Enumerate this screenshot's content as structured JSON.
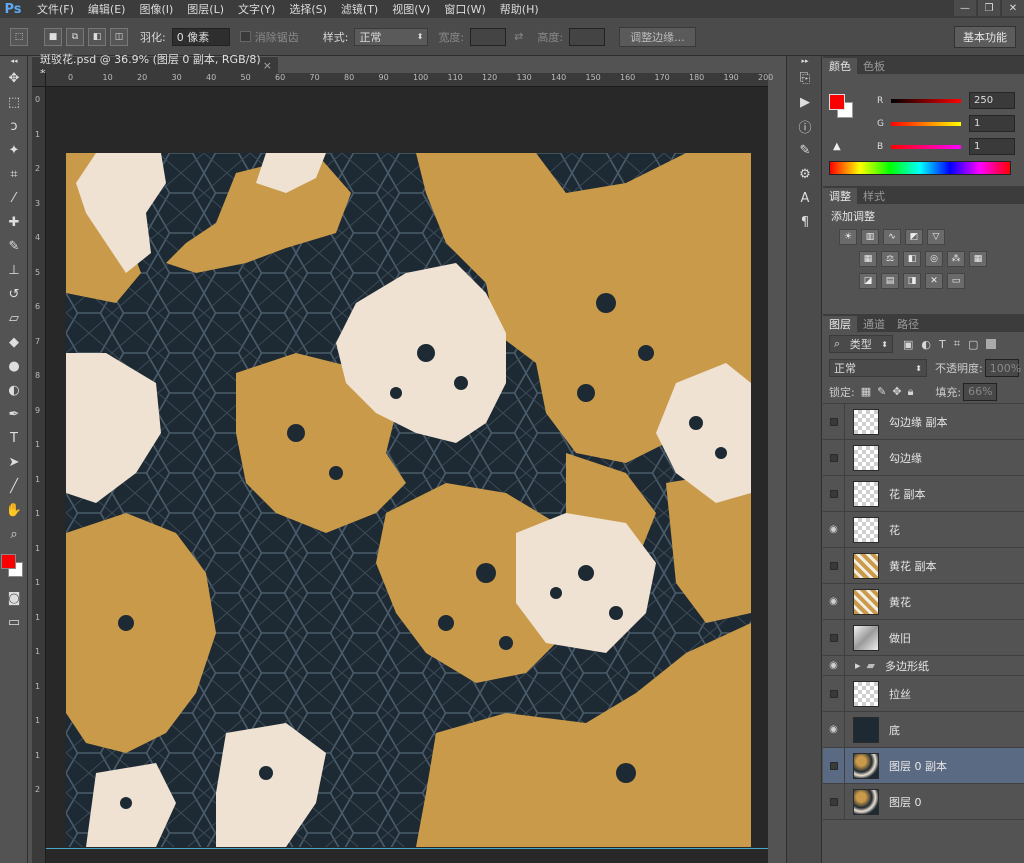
{
  "app": {
    "logo": "Ps"
  },
  "menubar": {
    "items": [
      "文件(F)",
      "编辑(E)",
      "图像(I)",
      "图层(L)",
      "文字(Y)",
      "选择(S)",
      "滤镜(T)",
      "视图(V)",
      "窗口(W)",
      "帮助(H)"
    ],
    "window_controls": [
      "—",
      "❐",
      "✕"
    ]
  },
  "options": {
    "feather_label": "羽化:",
    "feather_value": "0 像素",
    "antialias_label": "消除锯齿",
    "style_label": "样式:",
    "style_value": "正常",
    "width_label": "宽度:",
    "height_label": "高度:",
    "refine_edge_button": "调整边缘...",
    "workspace": "基本功能"
  },
  "document": {
    "tab_title": "斑驳花.psd @ 36.9% (图层 0 副本, RGB/8) *",
    "close": "×",
    "ruler_top_ticks": [
      "0",
      "10",
      "20",
      "30",
      "40",
      "50",
      "60",
      "70",
      "80",
      "90",
      "100",
      "110",
      "120",
      "130",
      "140",
      "150",
      "160",
      "170",
      "180",
      "190",
      "200"
    ],
    "ruler_left_ticks": [
      "0",
      "1",
      "2",
      "3",
      "4",
      "5",
      "6",
      "7",
      "8",
      "9",
      "1",
      "1",
      "1",
      "1",
      "1",
      "1",
      "1",
      "1",
      "1",
      "1",
      "2"
    ],
    "canvas_colors": {
      "background": "#1e2a33",
      "lattice": "#4a5c6b",
      "gold": "#c99a4a",
      "cream": "#efe2d2"
    }
  },
  "color_panel": {
    "tabs": [
      "颜色",
      "色板"
    ],
    "foreground": "#fa0101",
    "background": "#ffffff",
    "sliders": [
      {
        "label": "R",
        "value": "250"
      },
      {
        "label": "G",
        "value": "1"
      },
      {
        "label": "B",
        "value": "1"
      }
    ]
  },
  "adjustments_panel": {
    "tabs": [
      "调整",
      "样式"
    ],
    "title": "添加调整"
  },
  "layers_panel": {
    "tabs": [
      "图层",
      "通道",
      "路径"
    ],
    "filter_kind": "类型",
    "blend_mode": "正常",
    "opacity_label": "不透明度:",
    "opacity_value": "100%",
    "lock_label": "锁定:",
    "fill_label": "填充:",
    "fill_value": "66%",
    "layers": [
      {
        "name": "勾边缘 副本",
        "visible": false,
        "thumb": "transparent"
      },
      {
        "name": "勾边缘",
        "visible": false,
        "thumb": "transparent"
      },
      {
        "name": "花 副本",
        "visible": false,
        "thumb": "transparent"
      },
      {
        "name": "花",
        "visible": true,
        "thumb": "transparent"
      },
      {
        "name": "黄花 副本",
        "visible": false,
        "thumb": "gold"
      },
      {
        "name": "黄花",
        "visible": true,
        "thumb": "gold"
      },
      {
        "name": "做旧",
        "visible": false,
        "thumb": "gray"
      },
      {
        "name": "多边形纸",
        "visible": true,
        "thumb": "folder"
      },
      {
        "name": "拉丝",
        "visible": false,
        "thumb": "transparent"
      },
      {
        "name": "底",
        "visible": true,
        "thumb": "dark"
      },
      {
        "name": "图层 0 副本",
        "visible": false,
        "thumb": "pattern",
        "selected": true
      },
      {
        "name": "图层 0",
        "visible": false,
        "thumb": "pattern"
      }
    ]
  }
}
